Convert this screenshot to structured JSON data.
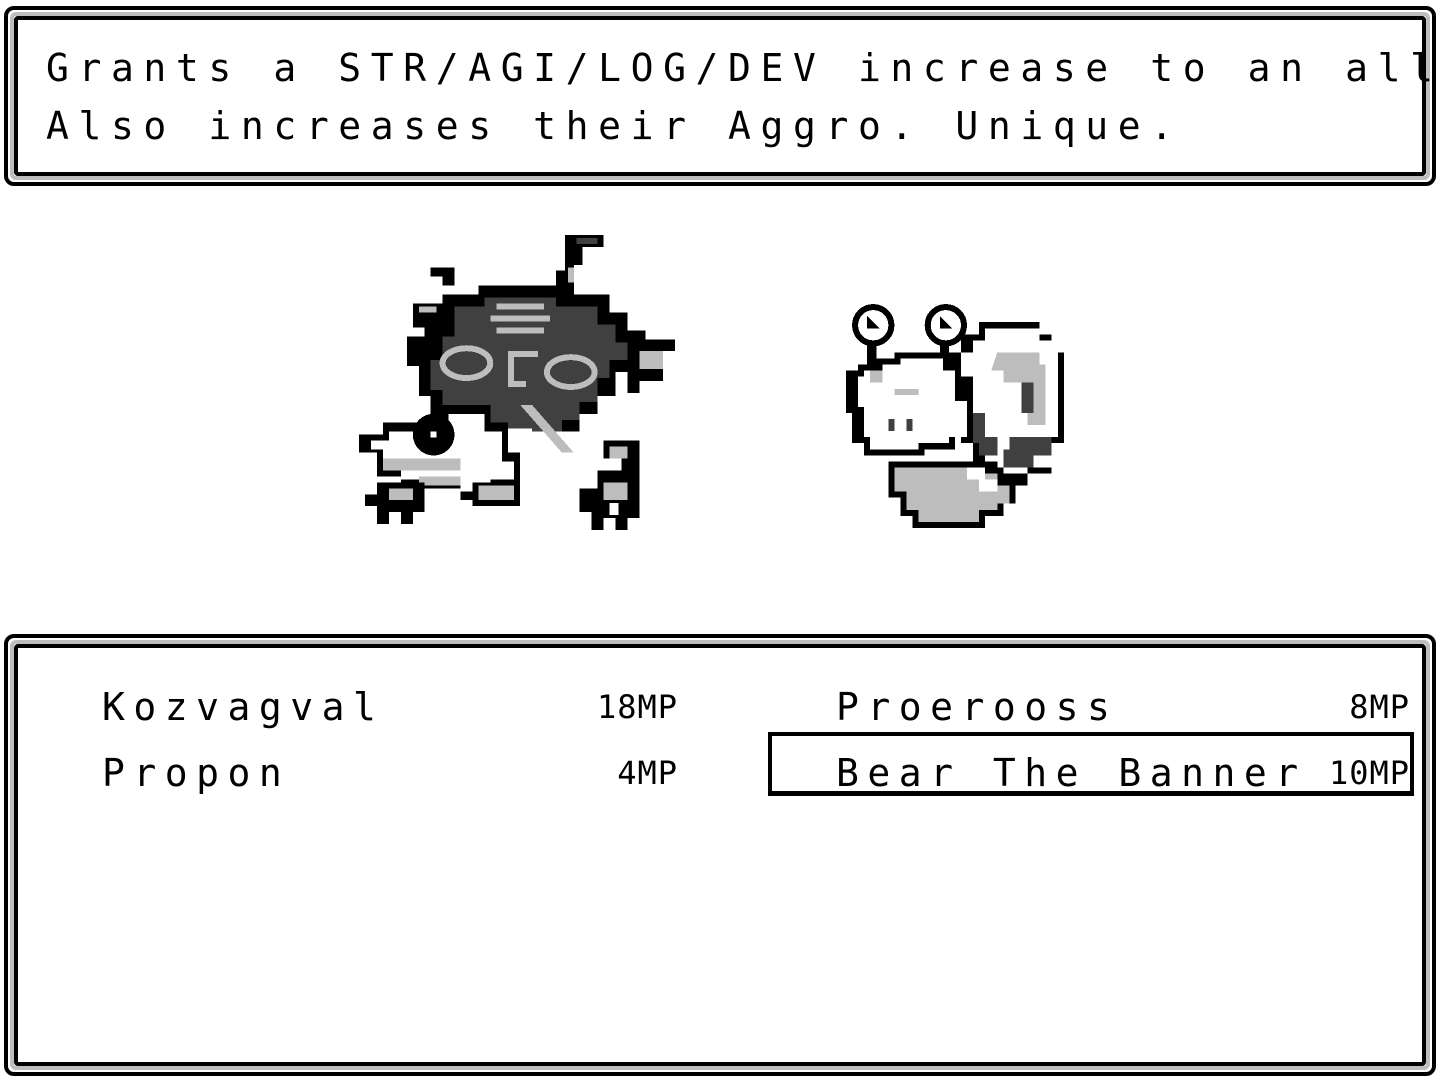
{
  "description": {
    "lines": [
      "Grants a STR/AGI/LOG/DEV increase to an ally.",
      "Also increases their Aggro. Unique."
    ]
  },
  "battlefield": {
    "enemies": [
      {
        "name": "turtle-creature",
        "icon": "turtle-sprite"
      },
      {
        "name": "snail-creature",
        "icon": "snail-sprite"
      }
    ]
  },
  "skill_menu": {
    "skills": [
      {
        "name": "Kozvagval",
        "cost": "18MP"
      },
      {
        "name": "Propon",
        "cost": "4MP"
      },
      {
        "name": "Proerooss",
        "cost": "8MP"
      },
      {
        "name": "Bear The Banner",
        "cost": "10MP"
      }
    ],
    "selected_index": 3
  },
  "palette": {
    "black": "#000000",
    "dark_grey": "#404040",
    "light_grey": "#bdbdbd",
    "white": "#ffffff"
  }
}
